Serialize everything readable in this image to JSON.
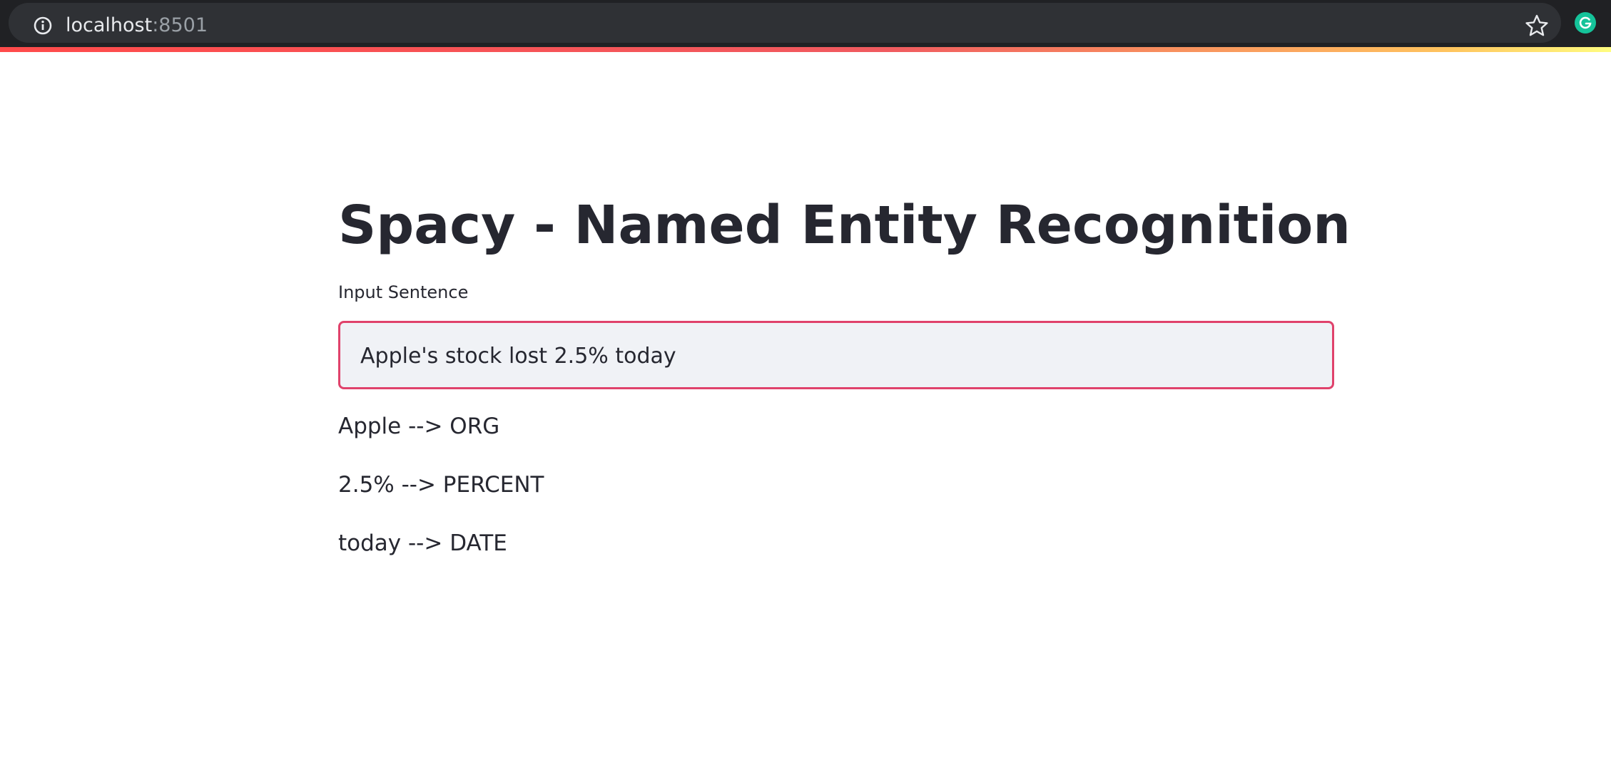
{
  "browser": {
    "url_host": "localhost",
    "url_port": ":8501",
    "icons": [
      "info-icon",
      "star-icon",
      "grammarly-extension-icon"
    ]
  },
  "colors": {
    "input_border": "#e0426b",
    "input_background": "#f0f2f6",
    "text": "#262730"
  },
  "app": {
    "title": "Spacy - Named Entity Recognition",
    "input_label": "Input Sentence",
    "input_value": "Apple's stock lost 2.5% today",
    "entities": [
      "Apple --> ORG",
      "2.5% --> PERCENT",
      "today --> DATE"
    ]
  }
}
